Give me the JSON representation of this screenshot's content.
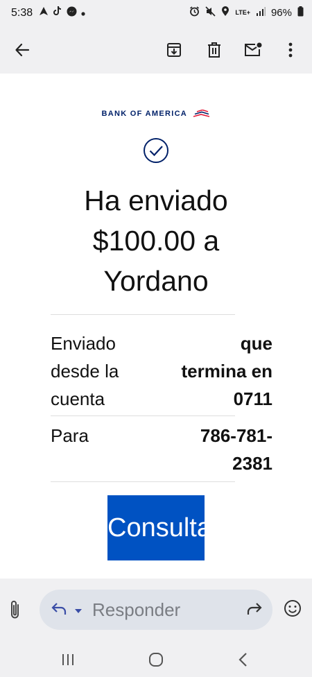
{
  "status_bar": {
    "time": "5:38",
    "network": "LTE+",
    "battery": "96%"
  },
  "toolbar": {
    "back": "back",
    "archive": "archive",
    "delete": "delete",
    "mark_unread": "mark-unread",
    "more": "more"
  },
  "email": {
    "brand": "BANK OF AMERICA",
    "headline_line1": "Ha enviado",
    "headline_line2": "$100.00 a",
    "headline_line3": "Yordano",
    "from_label": [
      "Enviado",
      "desde la",
      "cuenta"
    ],
    "from_value": [
      "que",
      "termina en",
      "0711"
    ],
    "to_label": "Para",
    "to_value": [
      "786-781-",
      "2381"
    ],
    "cta_label": "Consulta"
  },
  "reply": {
    "placeholder": "Responder"
  },
  "colors": {
    "cta_bg": "#0052c2",
    "brand_navy": "#012169",
    "brand_red": "#e31837"
  }
}
